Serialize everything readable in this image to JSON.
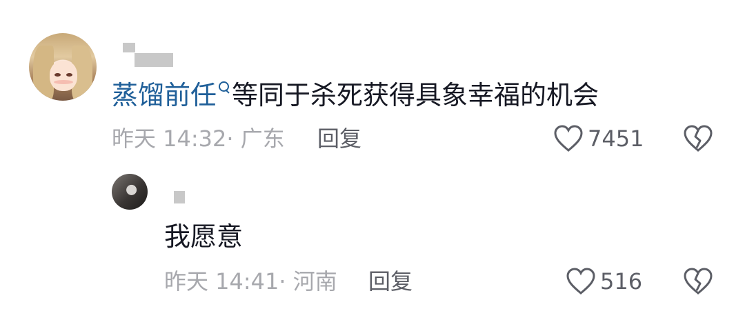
{
  "comment": {
    "mention": "蒸馏前任",
    "mention_icon": "search-icon",
    "text": "等同于杀死获得具象幸福的机会",
    "time": "昨天 14:32",
    "location": "· 广东",
    "reply_label": "回复",
    "likes": "7451",
    "like_icon": "heart-outline-icon",
    "dislike_icon": "broken-heart-icon"
  },
  "reply": {
    "text": "我愿意",
    "time": "昨天 14:41",
    "location": "· 河南",
    "reply_label": "回复",
    "likes": "516",
    "like_icon": "heart-outline-icon",
    "dislike_icon": "broken-heart-icon"
  },
  "colors": {
    "mention": "#1f5f99",
    "meta": "#a7a8ad",
    "icon": "#5c5e66"
  }
}
